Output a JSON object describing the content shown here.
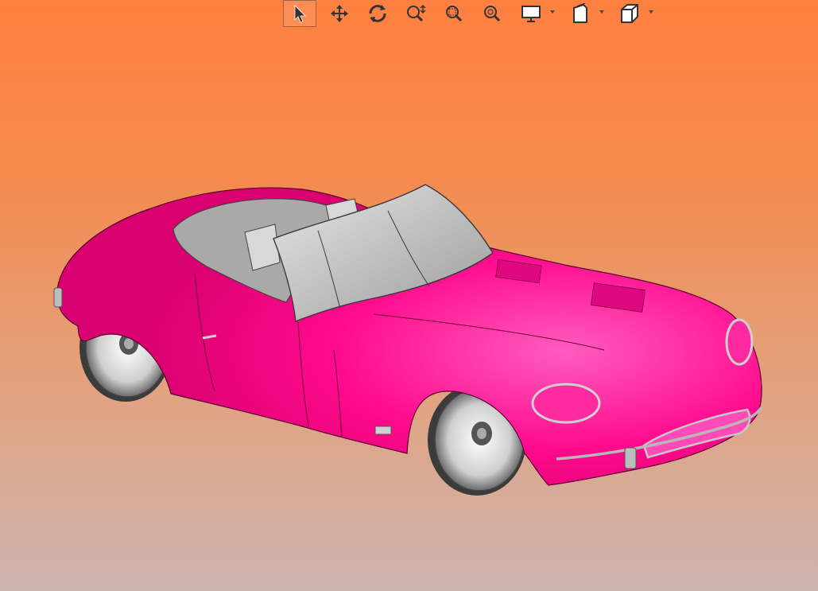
{
  "viewer": {
    "background_top": "#ff8040",
    "background_bottom": "#cdb4b1",
    "model_color": "#ff0a8c",
    "trim_color": "#c8c8c8"
  },
  "toolbar": {
    "tools": [
      {
        "id": "select",
        "icon": "cursor-arrow-icon",
        "active": true
      },
      {
        "id": "pan",
        "icon": "move-arrows-icon",
        "active": false
      },
      {
        "id": "rotate",
        "icon": "rotate-icon",
        "active": false
      },
      {
        "id": "zoom",
        "icon": "zoom-icon",
        "active": false
      },
      {
        "id": "zoom-window",
        "icon": "zoom-window-icon",
        "active": false
      },
      {
        "id": "zoom-fit",
        "icon": "zoom-fit-icon",
        "active": false
      },
      {
        "id": "display",
        "icon": "monitor-icon",
        "dropdown": true
      },
      {
        "id": "view-orientation",
        "icon": "view-cube-sheet-icon",
        "dropdown": true
      },
      {
        "id": "standard-views",
        "icon": "cube-icon",
        "dropdown": true
      }
    ]
  }
}
